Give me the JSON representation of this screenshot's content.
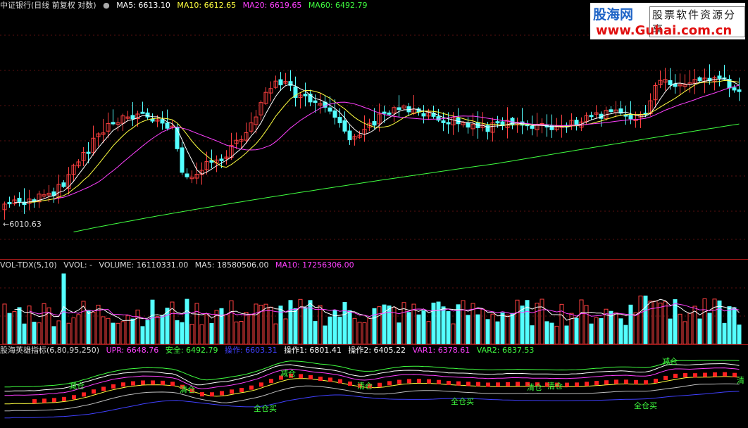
{
  "main": {
    "title": "中证银行(日线 前复权 对数)",
    "ma5": "MA5: 6613.10",
    "ma10": "MA10: 6612.65",
    "ma20": "MA20: 6619.65",
    "ma60": "MA60: 6492.79",
    "min_label": "←6010.63",
    "colors": {
      "up": "#ff4040",
      "down": "#54ffff",
      "ma5": "#ffffff",
      "ma10": "#ffff40",
      "ma20": "#ff40ff",
      "ma60": "#40ff40"
    }
  },
  "volume": {
    "indicator": "VOL-TDX(5,10)",
    "vvol": "VVOL: -",
    "volume": "VOLUME: 16110331.00",
    "ma5": "MA5: 18580506.00",
    "ma10": "MA10: 17256306.00"
  },
  "hero": {
    "indicator": "股海英雄指标(6,80,95,250)",
    "upr": "UPR: 6648.76",
    "safe": "安全: 6492.79",
    "op": "操作: 6603.31",
    "op1": "操作1: 6801.41",
    "op2": "操作2: 6405.22",
    "var1": "VAR1: 6378.61",
    "var2": "VAR2: 6837.53",
    "tags": {
      "jiancang1": "减仓",
      "jiancang2": "减仓",
      "jiancang3": "减仓",
      "qingcang1": "清仓",
      "qingcang2": "清仓",
      "qingcang3": "清仓",
      "qingcang4": "清仓",
      "qingcang5": "清",
      "quancangmai1": "全仓买",
      "quancangmai2": "全仓买",
      "quancangmai3": "全仓买"
    }
  },
  "watermark": {
    "brand": "股海网",
    "slogan": "股票软件资源分享",
    "url": "www.Guhai.com.cn"
  }
}
